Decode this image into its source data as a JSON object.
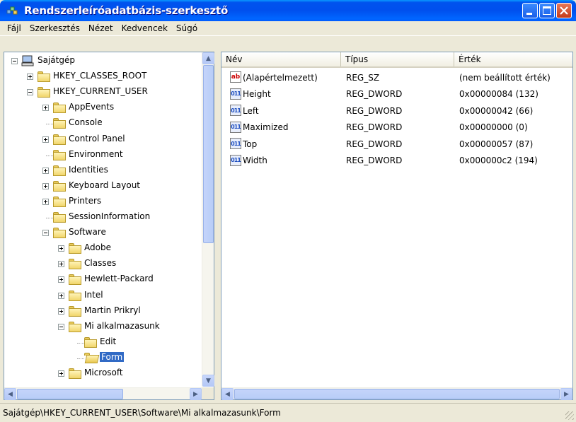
{
  "window": {
    "title": "Rendszerleíróadatbázis-szerkesztő"
  },
  "menu": [
    {
      "label": "Fájl"
    },
    {
      "label": "Szerkesztés"
    },
    {
      "label": "Nézet"
    },
    {
      "label": "Kedvencek"
    },
    {
      "label": "Súgó"
    }
  ],
  "tree": {
    "items": [
      {
        "label": "Sajátgép",
        "level": 0,
        "expander": "minus",
        "icon": "computer-icon"
      },
      {
        "label": "HKEY_CLASSES_ROOT",
        "level": 1,
        "expander": "plus",
        "icon": "folder-icon"
      },
      {
        "label": "HKEY_CURRENT_USER",
        "level": 1,
        "expander": "minus",
        "icon": "folder-icon"
      },
      {
        "label": "AppEvents",
        "level": 2,
        "expander": "plus",
        "icon": "folder-icon"
      },
      {
        "label": "Console",
        "level": 2,
        "expander": "none",
        "icon": "folder-icon"
      },
      {
        "label": "Control Panel",
        "level": 2,
        "expander": "plus",
        "icon": "folder-icon"
      },
      {
        "label": "Environment",
        "level": 2,
        "expander": "none",
        "icon": "folder-icon"
      },
      {
        "label": "Identities",
        "level": 2,
        "expander": "plus",
        "icon": "folder-icon"
      },
      {
        "label": "Keyboard Layout",
        "level": 2,
        "expander": "plus",
        "icon": "folder-icon"
      },
      {
        "label": "Printers",
        "level": 2,
        "expander": "plus",
        "icon": "folder-icon"
      },
      {
        "label": "SessionInformation",
        "level": 2,
        "expander": "none",
        "icon": "folder-icon"
      },
      {
        "label": "Software",
        "level": 2,
        "expander": "minus",
        "icon": "folder-icon"
      },
      {
        "label": "Adobe",
        "level": 3,
        "expander": "plus",
        "icon": "folder-icon"
      },
      {
        "label": "Classes",
        "level": 3,
        "expander": "plus",
        "icon": "folder-icon"
      },
      {
        "label": "Hewlett-Packard",
        "level": 3,
        "expander": "plus",
        "icon": "folder-icon"
      },
      {
        "label": "Intel",
        "level": 3,
        "expander": "plus",
        "icon": "folder-icon"
      },
      {
        "label": "Martin Prikryl",
        "level": 3,
        "expander": "plus",
        "icon": "folder-icon"
      },
      {
        "label": "Mi alkalmazasunk",
        "level": 3,
        "expander": "minus",
        "icon": "folder-icon"
      },
      {
        "label": "Edit",
        "level": 4,
        "expander": "none",
        "icon": "folder-icon"
      },
      {
        "label": "Form",
        "level": 4,
        "expander": "none",
        "icon": "open-folder-icon",
        "selected": true
      },
      {
        "label": "Microsoft",
        "level": 3,
        "expander": "plus",
        "icon": "folder-icon"
      }
    ]
  },
  "list": {
    "columns": [
      "Név",
      "Típus",
      "Érték"
    ],
    "rows": [
      {
        "name": "(Alapértelmezett)",
        "type": "REG_SZ",
        "value": "(nem beállított érték)",
        "icon": "string-value-icon"
      },
      {
        "name": "Height",
        "type": "REG_DWORD",
        "value": "0x00000084 (132)",
        "icon": "binary-value-icon"
      },
      {
        "name": "Left",
        "type": "REG_DWORD",
        "value": "0x00000042 (66)",
        "icon": "binary-value-icon"
      },
      {
        "name": "Maximized",
        "type": "REG_DWORD",
        "value": "0x00000000 (0)",
        "icon": "binary-value-icon"
      },
      {
        "name": "Top",
        "type": "REG_DWORD",
        "value": "0x00000057 (87)",
        "icon": "binary-value-icon"
      },
      {
        "name": "Width",
        "type": "REG_DWORD",
        "value": "0x000000c2 (194)",
        "icon": "binary-value-icon"
      }
    ]
  },
  "status": {
    "path": "Sajátgép\\HKEY_CURRENT_USER\\Software\\Mi alkalmazasunk\\Form"
  },
  "colors": {
    "titlebar": "#0054e3",
    "selection": "#316ac5",
    "accent_close": "#c63b17"
  }
}
